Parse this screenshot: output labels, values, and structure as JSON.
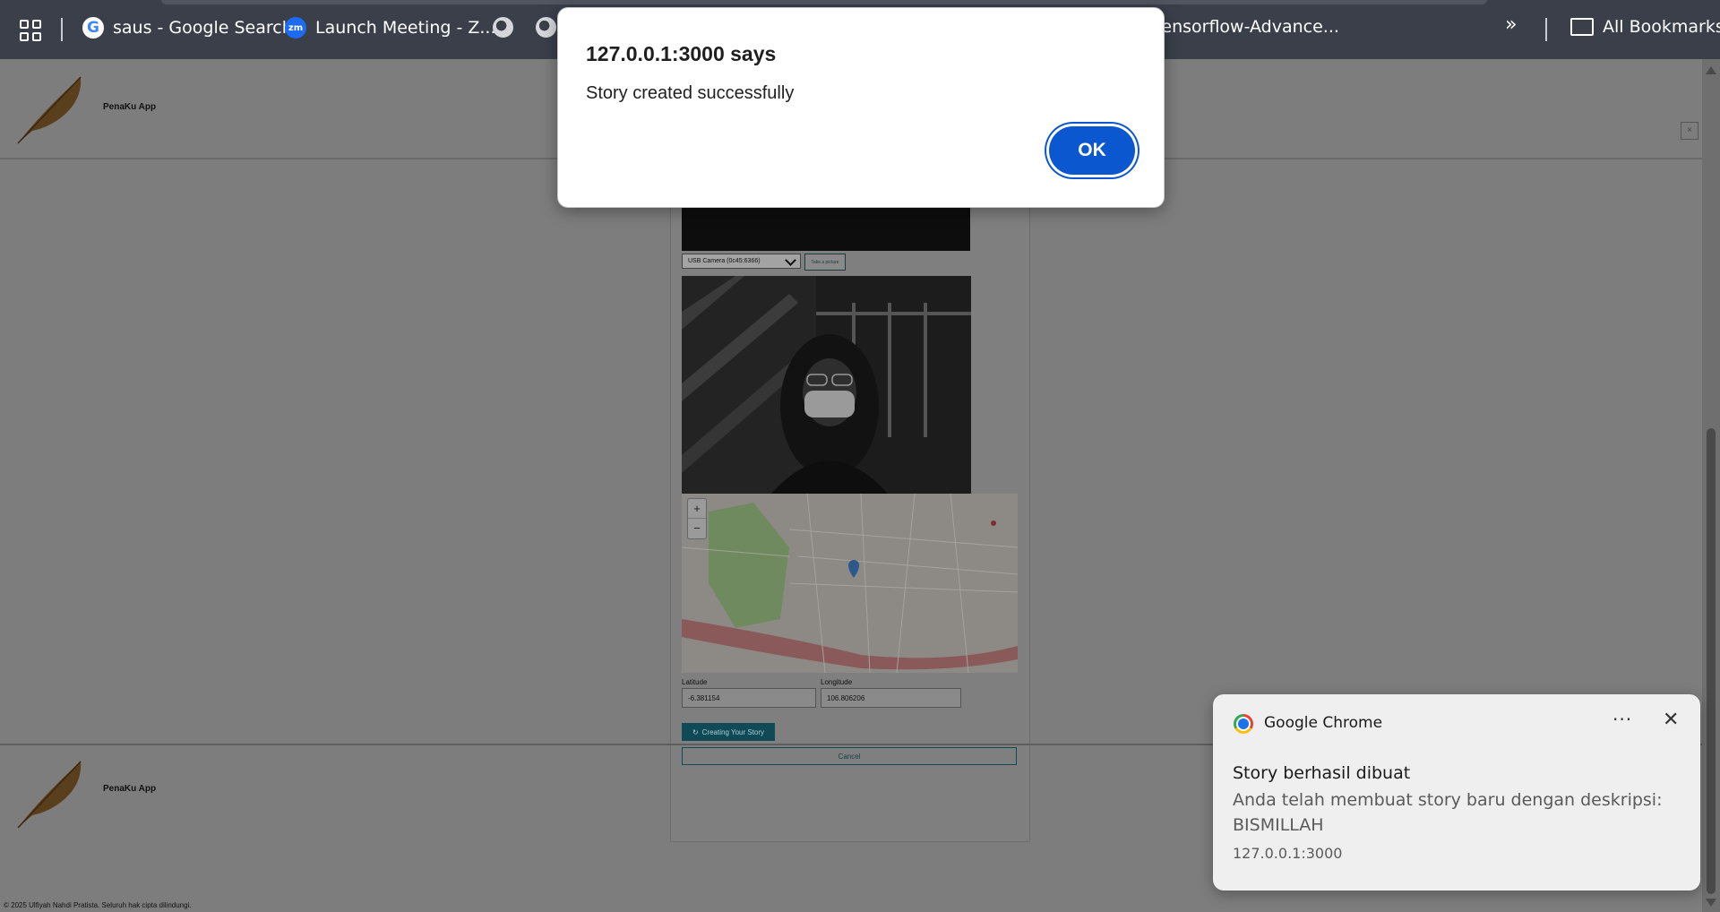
{
  "bookmarks_bar": {
    "items": [
      {
        "label": "saus - Google Search",
        "icon": "google-icon"
      },
      {
        "label": "Launch Meeting - Z...",
        "icon": "zoom-icon"
      },
      {
        "label": "",
        "icon": "globe-icon"
      },
      {
        "label": "",
        "icon": "globe-icon"
      },
      {
        "label": "Tensorflow-Advance...",
        "icon": "globe-icon"
      }
    ],
    "all_bookmarks": "All Bookmarks",
    "overflow": "»"
  },
  "page": {
    "brand": "PenaKu App",
    "camera_select": "USB Camera (0c45:6366)",
    "take_picture": "Take a picture",
    "latitude_label": "Latitude",
    "latitude_value": "-6.381154",
    "longitude_label": "Longitude",
    "longitude_value": "106.806206",
    "create_button": "Creating Your Story",
    "cancel_button": "Cancel",
    "map_zoom_in": "+",
    "map_zoom_out": "−",
    "copyright": "© 2025 Ulfiyah Nahdi Pratista. Seluruh hak cipta dilindungi."
  },
  "dialog": {
    "title": "127.0.0.1:3000 says",
    "message": "Story created successfully",
    "ok": "OK"
  },
  "notification": {
    "app": "Google Chrome",
    "more": "···",
    "close": "✕",
    "title": "Story berhasil dibuat",
    "body": "Anda telah membuat story baru dengan deskripsi: BISMILLAH",
    "origin": "127.0.0.1:3000"
  },
  "colors": {
    "dialog_button": "#0b57d0",
    "create_button": "#0f4a56",
    "bookmarks_bar": "#3a3f4a"
  }
}
